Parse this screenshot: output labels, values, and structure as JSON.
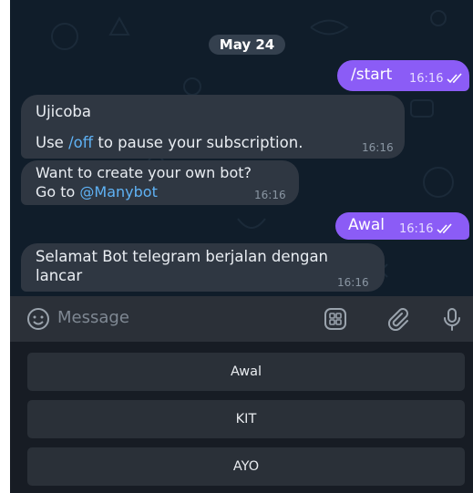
{
  "chat": {
    "date": "May 24",
    "messages": [
      {
        "id": "m1",
        "direction": "out",
        "text": "/start",
        "time": "16:16"
      },
      {
        "id": "m2",
        "direction": "in",
        "line1": "Ujicoba",
        "line2_pre": "Use ",
        "line2_cmd": "/off",
        "line2_post": " to pause your subscription.",
        "time": "16:16"
      },
      {
        "id": "m3",
        "direction": "in",
        "line1": "Want to create your own bot?",
        "line2_pre": "Go to ",
        "line2_link": "@Manybot",
        "time": "16:16"
      },
      {
        "id": "m4",
        "direction": "out",
        "text": "Awal",
        "time": "16:16"
      },
      {
        "id": "m5",
        "direction": "in",
        "line1": "Selamat Bot telegram berjalan dengan",
        "line2": "lancar",
        "time": "16:16"
      }
    ]
  },
  "input": {
    "placeholder": "Message",
    "icons": [
      "emoji-icon",
      "bot-keyboard-icon",
      "attach-icon",
      "mic-icon"
    ]
  },
  "keyboard": {
    "buttons": [
      "Awal",
      "KIT",
      "AYO"
    ]
  },
  "colors": {
    "outgoing_bubble": "#8b5cf6",
    "incoming_bubble": "#2f3742",
    "link": "#5fb2f5",
    "chat_background": "#101d2a"
  }
}
